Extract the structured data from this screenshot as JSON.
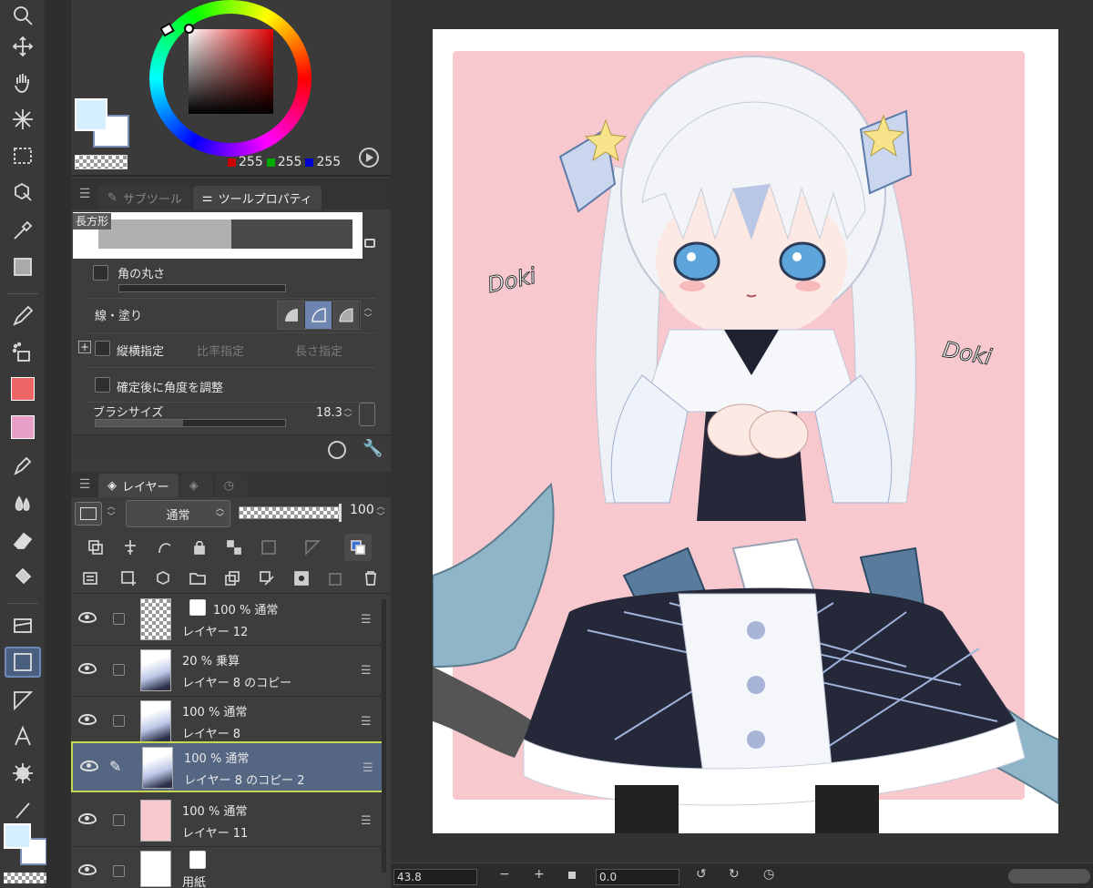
{
  "color_panel": {
    "rgb_r": "255",
    "rgb_g": "255",
    "rgb_b": "255",
    "fg_color": "#d6efff",
    "bg_color": "#ffffff"
  },
  "tool_property": {
    "tabs": [
      "サブツール",
      "ツールプロパティ"
    ],
    "active_tab": "ツールプロパティ",
    "preview_label": "長方形",
    "rows": {
      "corner_round": "角の丸さ",
      "line_fill": "線・塗り",
      "aspect": "縦横指定",
      "ratio": "比率指定",
      "length": "長さ指定",
      "adjust_angle": "確定後に角度を調整",
      "brush_size": "ブラシサイズ",
      "brush_size_value": "18.3"
    }
  },
  "layer_panel": {
    "tab_label": "レイヤー",
    "blend_mode": "通常",
    "opacity": "100",
    "layers": [
      {
        "meta": "100 % 通常",
        "name": "レイヤー 12",
        "thumb": "transparent"
      },
      {
        "meta": "20 % 乗算",
        "name": "レイヤー 8 のコピー",
        "thumb": "art"
      },
      {
        "meta": "100 % 通常",
        "name": "レイヤー 8",
        "thumb": "art"
      },
      {
        "meta": "100 % 通常",
        "name": "レイヤー 8 のコピー 2",
        "thumb": "art",
        "selected": true
      },
      {
        "meta": "100 % 通常",
        "name": "レイヤー 11",
        "thumb": "#f7c9cf"
      },
      {
        "meta": "",
        "name": "用紙",
        "thumb": "#ffffff"
      }
    ]
  },
  "canvas": {
    "doki_left": "Doki",
    "doki_right": "Doki",
    "background_color": "#f7c9cf"
  },
  "bottom_bar": {
    "zoom": "43.8",
    "rotation": "0.0",
    "minus": "−",
    "plus": "+"
  }
}
